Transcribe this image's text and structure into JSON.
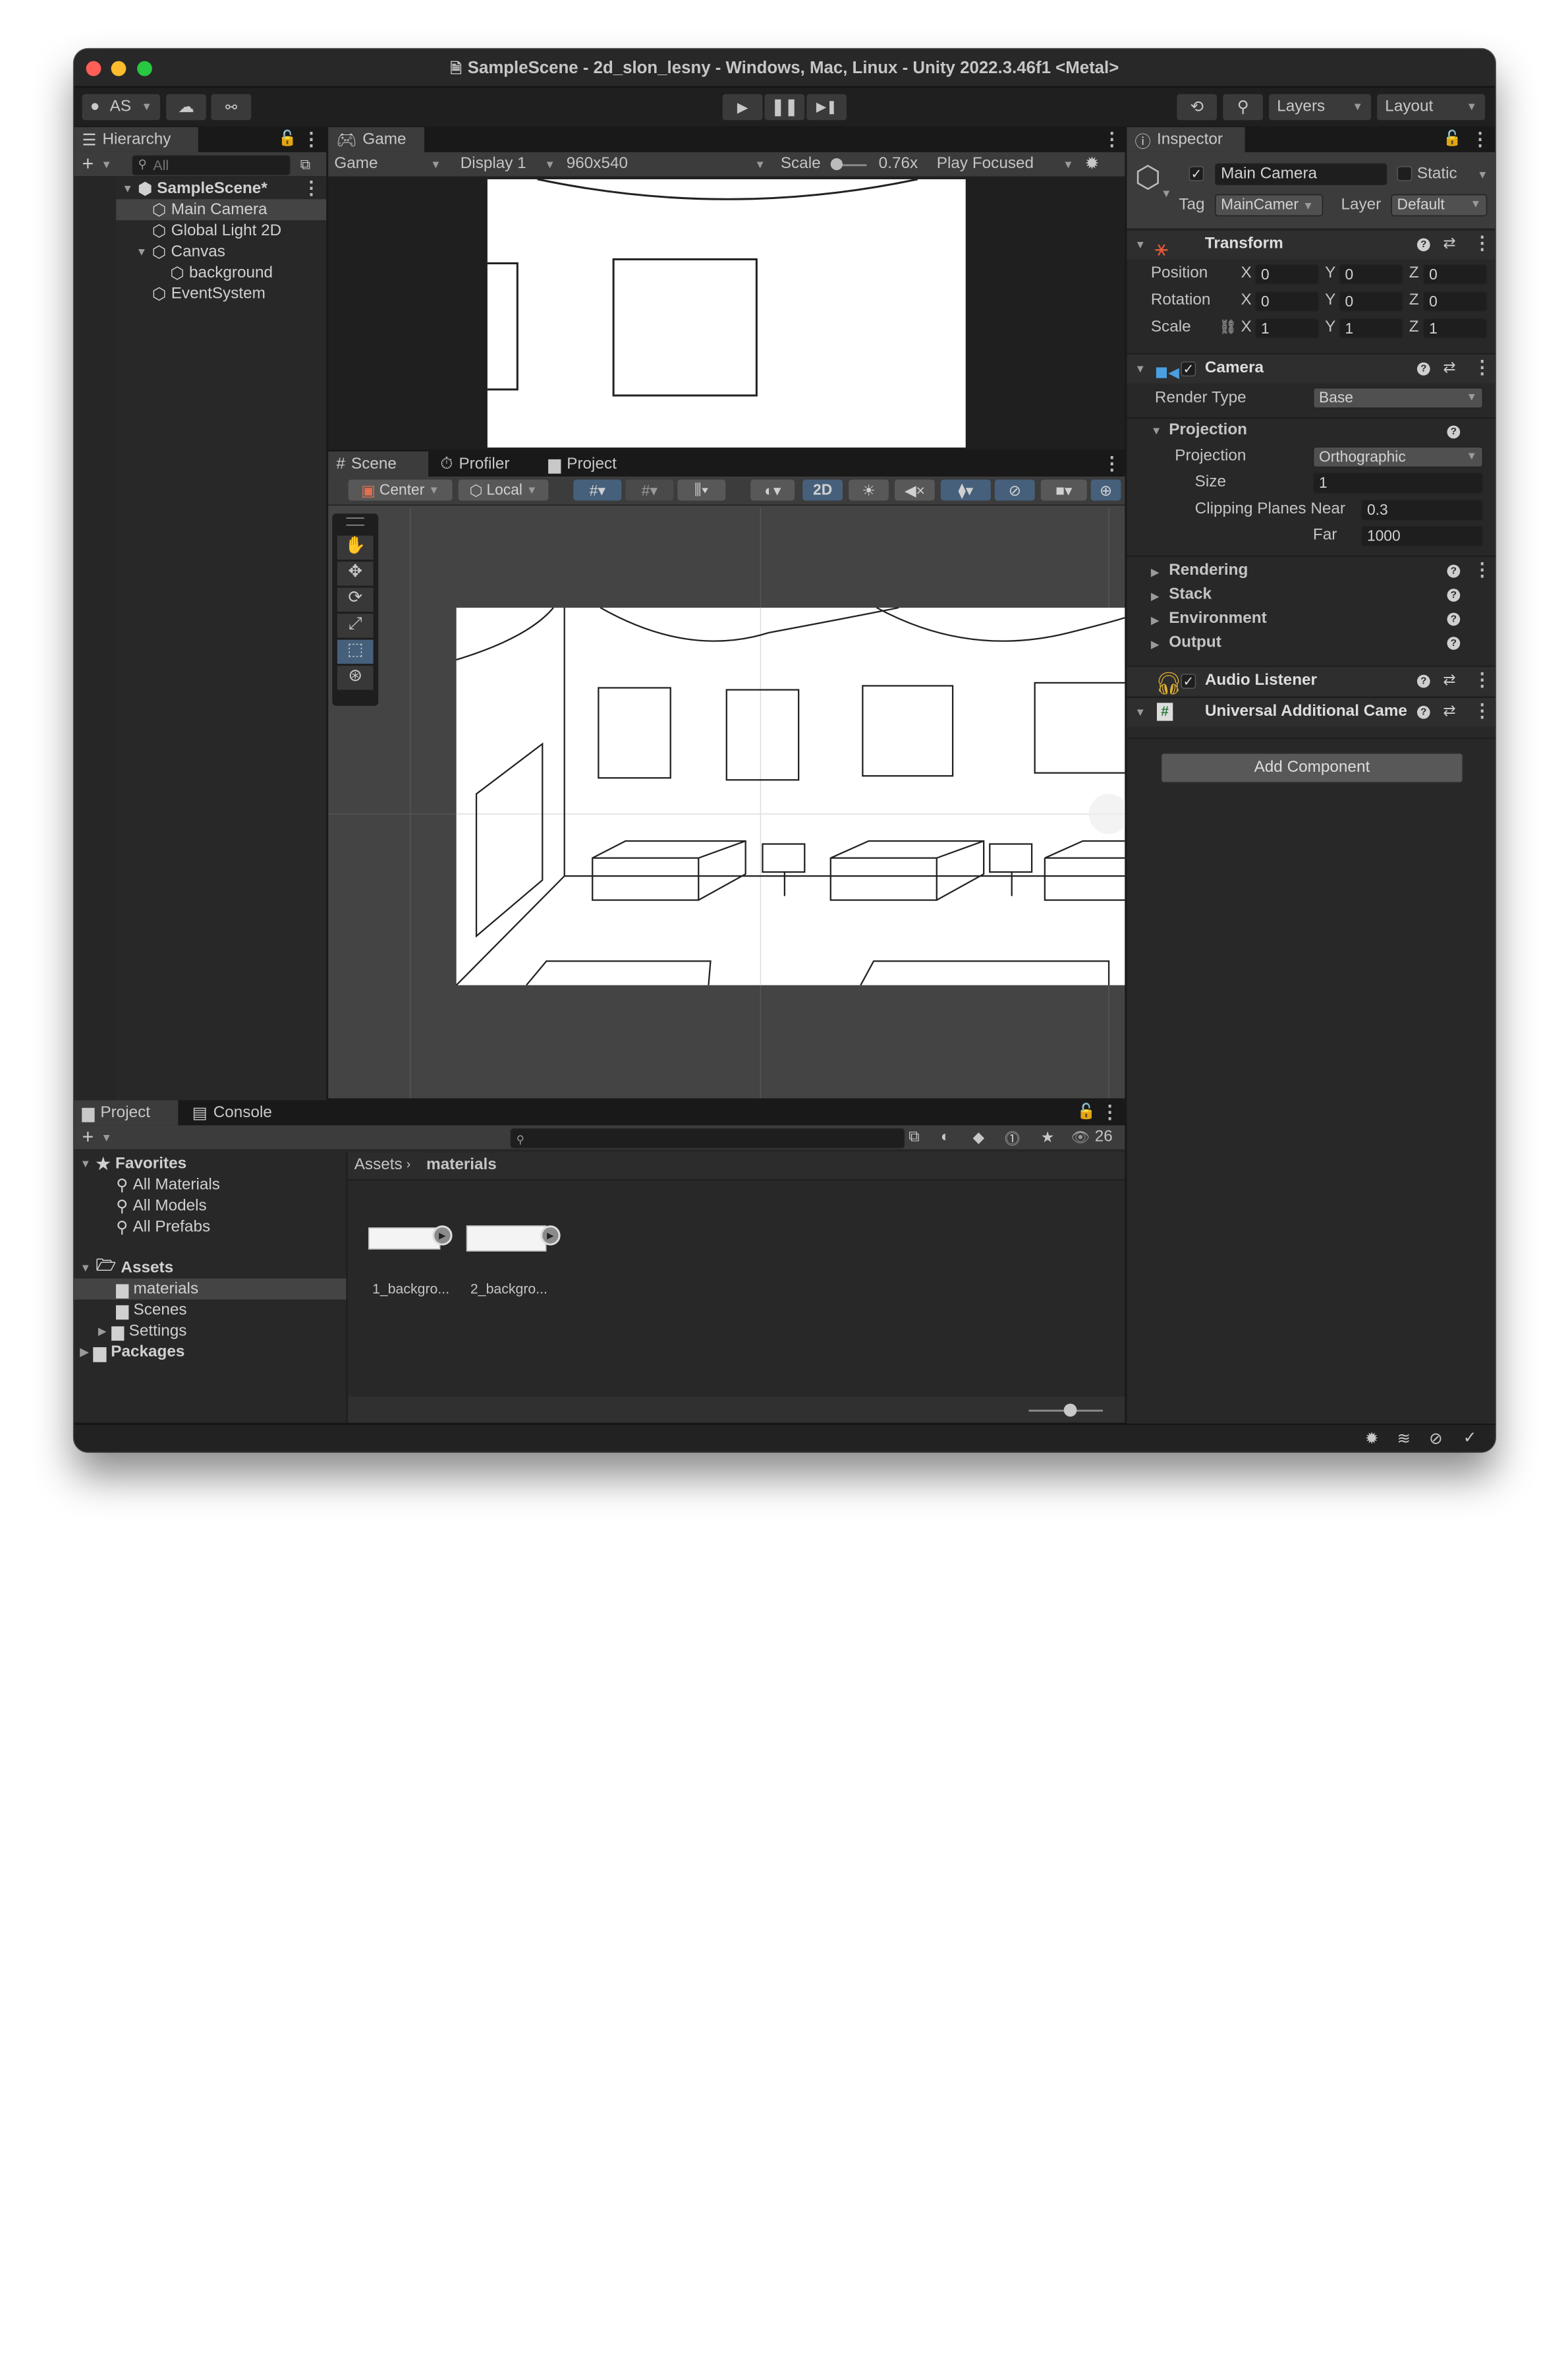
{
  "window": {
    "title": "SampleScene - 2d_slon_lesny - Windows, Mac, Linux - Unity 2022.3.46f1 <Metal>",
    "colors": {
      "close": "#ff5f57",
      "minimize": "#febc2e",
      "zoom": "#28c840"
    }
  },
  "toolbar": {
    "account": "AS",
    "layers": "Layers",
    "layout": "Layout",
    "icons": [
      "cloud-icon",
      "collab-icon",
      "play-icon",
      "pause-icon",
      "step-icon",
      "history-icon",
      "search-icon"
    ]
  },
  "hierarchy": {
    "tab": "Hierarchy",
    "search_placeholder": "All",
    "scene": "SampleScene*",
    "items": [
      "Main Camera",
      "Global Light 2D",
      "Canvas",
      "background",
      "EventSystem"
    ]
  },
  "game": {
    "tab": "Game",
    "mode": "Game",
    "display": "Display 1",
    "resolution": "960x540",
    "scale_label": "Scale",
    "scale_value": "0.76x",
    "play_mode": "Play Focused"
  },
  "scene": {
    "tabs": [
      "Scene",
      "Profiler",
      "Project"
    ],
    "pivot": "Center",
    "space": "Local",
    "mode_2d": "2D"
  },
  "inspector": {
    "tab": "Inspector",
    "object_name": "Main Camera",
    "static_label": "Static",
    "tag_label": "Tag",
    "tag_value": "MainCamer",
    "layer_label": "Layer",
    "layer_value": "Default",
    "transform": {
      "title": "Transform",
      "rows": [
        {
          "label": "Position",
          "x": "0",
          "y": "0",
          "z": "0"
        },
        {
          "label": "Rotation",
          "x": "0",
          "y": "0",
          "z": "0"
        },
        {
          "label": "Scale",
          "x": "1",
          "y": "1",
          "z": "1"
        }
      ],
      "axes": [
        "X",
        "Y",
        "Z"
      ]
    },
    "camera": {
      "title": "Camera",
      "render_type_label": "Render Type",
      "render_type": "Base",
      "projection_header": "Projection",
      "projection_label": "Projection",
      "projection": "Orthographic",
      "size_label": "Size",
      "size": "1",
      "clip_near_label": "Clipping Planes Near",
      "clip_near": "0.3",
      "far_label": "Far",
      "far": "1000",
      "sections": [
        "Rendering",
        "Stack",
        "Environment",
        "Output"
      ]
    },
    "audio_listener": "Audio Listener",
    "universal": "Universal Additional Came",
    "add_component": "Add Component"
  },
  "project": {
    "tabs": [
      "Project",
      "Console"
    ],
    "hidden_count": "26",
    "favorites": "Favorites",
    "favorite_items": [
      "All Materials",
      "All Models",
      "All Prefabs"
    ],
    "assets": "Assets",
    "asset_folders": [
      "materials",
      "Scenes",
      "Settings"
    ],
    "packages": "Packages",
    "breadcrumb": [
      "Assets",
      "materials"
    ],
    "files": [
      "1_backgro...",
      "2_backgro..."
    ],
    "icon_size_level": 0.55
  }
}
